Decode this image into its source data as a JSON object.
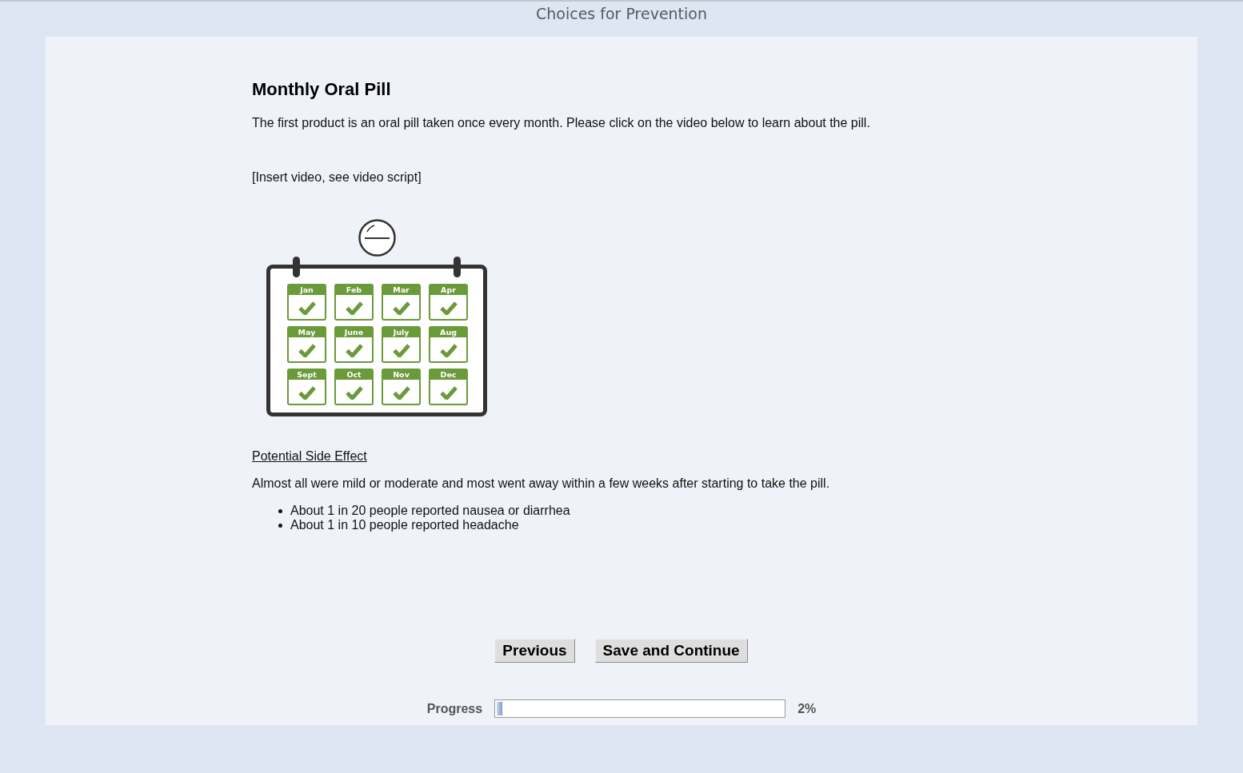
{
  "header": {
    "title": "Choices for Prevention"
  },
  "content": {
    "heading": "Monthly Oral Pill",
    "intro": "The first product is an oral pill taken once every month. Please click on the video below to learn about the pill.",
    "video_note": "[Insert video, see video script]",
    "calendar": {
      "months": [
        {
          "label": "Jan",
          "checked": true
        },
        {
          "label": "Feb",
          "checked": true
        },
        {
          "label": "Mar",
          "checked": true
        },
        {
          "label": "Apr",
          "checked": true
        },
        {
          "label": "May",
          "checked": true
        },
        {
          "label": "June",
          "checked": true
        },
        {
          "label": "July",
          "checked": true
        },
        {
          "label": "Aug",
          "checked": true
        },
        {
          "label": "Sept",
          "checked": true
        },
        {
          "label": "Oct",
          "checked": true
        },
        {
          "label": "Nov",
          "checked": true
        },
        {
          "label": "Dec",
          "checked": true
        }
      ]
    },
    "side_effects": {
      "heading": "Potential Side Effect",
      "summary": "Almost all were mild or moderate and most went away within a few weeks after starting to take the pill.",
      "items": [
        "About 1 in 20 people reported nausea or diarrhea",
        "About 1 in 10 people reported headache"
      ]
    }
  },
  "buttons": [
    {
      "label": "Previous"
    },
    {
      "label": "Save and Continue"
    }
  ],
  "progress": {
    "label": "Progress",
    "level": 0.02,
    "reading": "2%"
  }
}
